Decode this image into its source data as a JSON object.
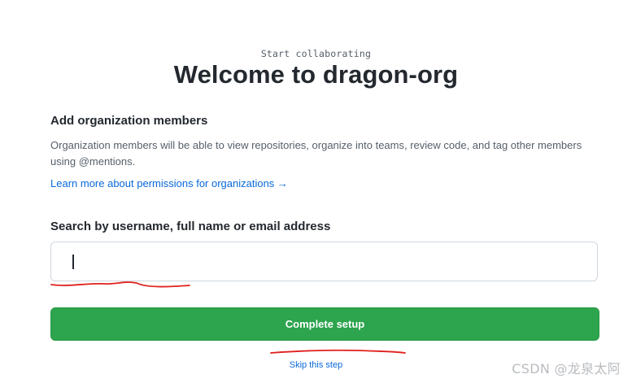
{
  "header": {
    "eyebrow": "Start collaborating",
    "title": "Welcome to dragon-org"
  },
  "members": {
    "section_title": "Add organization members",
    "description": "Organization members will be able to view repositories, organize into teams, review code, and tag other members using @mentions.",
    "learn_more_link": "Learn more about permissions for organizations →"
  },
  "search": {
    "label": "Search by username, full name or email address",
    "value": "",
    "placeholder": ""
  },
  "actions": {
    "complete_label": "Complete setup",
    "skip_label": "Skip this step"
  },
  "watermark": {
    "text": "CSDN @龙泉太阿"
  },
  "colors": {
    "accent_green": "#2da44e",
    "link_blue": "#0969da",
    "annotation_red": "#e0201c"
  }
}
